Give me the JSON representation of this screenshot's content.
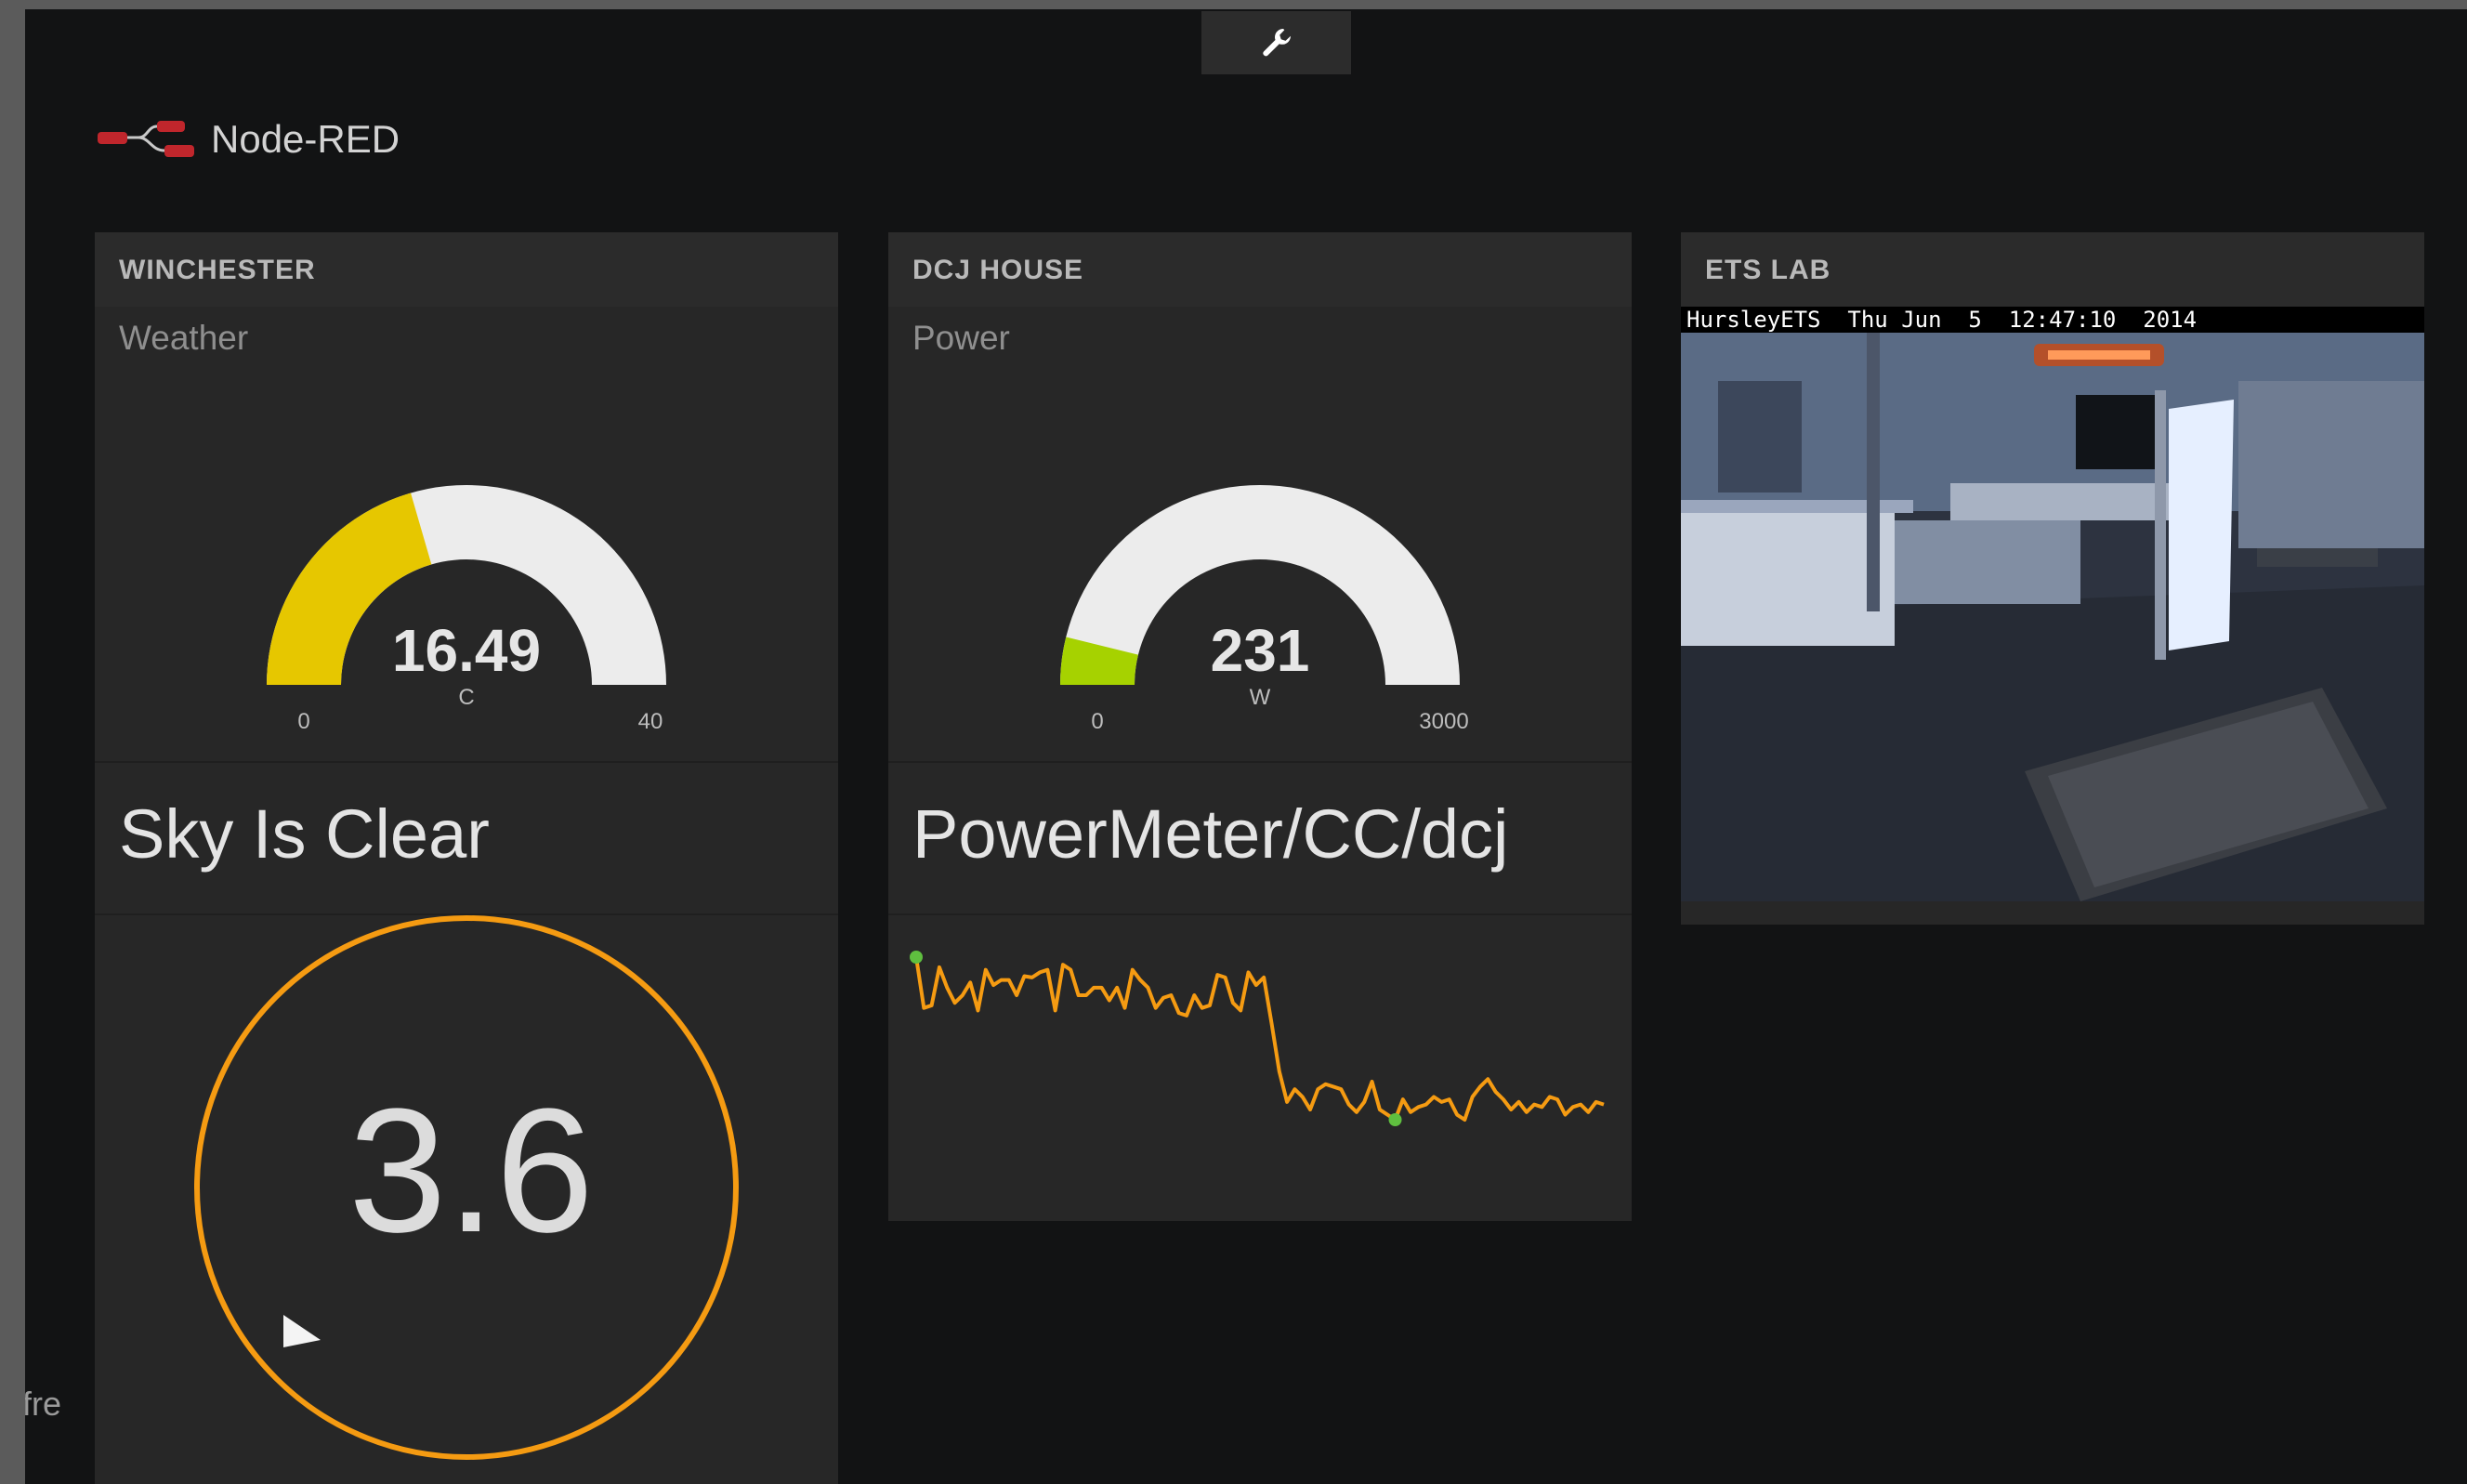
{
  "app": {
    "title": "Node-RED",
    "footer_fragment": "fre"
  },
  "toolbar": {
    "tools_icon": "wrench-icon"
  },
  "panels": [
    {
      "title": "WINCHESTER",
      "gauge": {
        "label": "Weather",
        "value": "16.49",
        "units": "C",
        "min": "0",
        "max": "40",
        "fraction": 0.41,
        "color": "#e6c700"
      },
      "text": "Sky Is Clear",
      "dial": {
        "value": "3.6",
        "ring_color": "#f59b12",
        "pointer_icon": "wind-direction-pointer-icon"
      }
    },
    {
      "title": "DCJ HOUSE",
      "gauge": {
        "label": "Power",
        "value": "231",
        "units": "W",
        "min": "0",
        "max": "3000",
        "fraction": 0.077,
        "color": "#a6d200"
      },
      "text": "PowerMeter/CC/dcj",
      "sparkline": {
        "color": "#f59b12",
        "marker_color": "#5fbf3f",
        "values": [
          3000,
          2600,
          2620,
          2920,
          2760,
          2640,
          2700,
          2800,
          2580,
          2900,
          2780,
          2820,
          2820,
          2700,
          2850,
          2840,
          2880,
          2900,
          2580,
          2940,
          2900,
          2700,
          2700,
          2760,
          2760,
          2660,
          2760,
          2600,
          2900,
          2820,
          2760,
          2600,
          2680,
          2700,
          2560,
          2540,
          2700,
          2600,
          2620,
          2860,
          2840,
          2640,
          2580,
          2880,
          2780,
          2840,
          2480,
          2100,
          1860,
          1960,
          1900,
          1800,
          1960,
          2000,
          1980,
          1960,
          1840,
          1780,
          1860,
          2020,
          1800,
          1760,
          1720,
          1880,
          1780,
          1820,
          1840,
          1900,
          1860,
          1880,
          1760,
          1720,
          1900,
          1980,
          2040,
          1940,
          1880,
          1800,
          1860,
          1780,
          1840,
          1820,
          1900,
          1880,
          1760,
          1820,
          1840,
          1780,
          1860,
          1840
        ]
      }
    },
    {
      "title": "ETS LAB",
      "camera": {
        "timestamp": "HursleyETS  Thu Jun  5  12:47:10  2014"
      }
    }
  ]
}
